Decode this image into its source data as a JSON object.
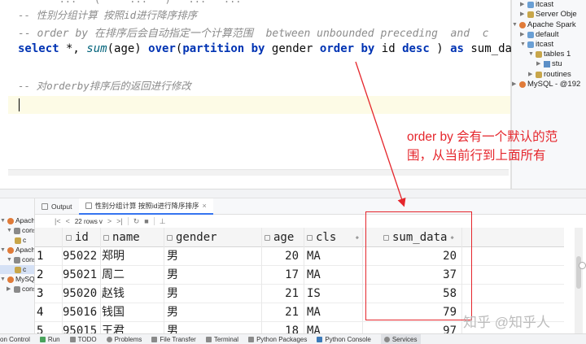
{
  "editor": {
    "top_line": "  --   ...   (     ...   )   ...   ...",
    "comment1": "-- 性别分组计算 按照id进行降序排序",
    "comment2": "-- order by 在排序后会自动指定一个计算范围  between unbounded preceding  and  c",
    "sql": {
      "kw_select": "select",
      "p1": " *, ",
      "fn_sum": "sum",
      "p2": "(age) ",
      "kw_over": "over",
      "p3": "(",
      "kw_partition_by": "partition by",
      "p4": " gender ",
      "kw_order_by": "order by",
      "p5": " id ",
      "kw_desc": "desc",
      "p6": " ) ",
      "kw_as": "as",
      "p7": " sum_data"
    },
    "comment3": "-- 对orderby排序后的返回进行修改"
  },
  "db_tree": [
    {
      "label": "itcast",
      "icon": "schema-icon"
    },
    {
      "label": "Server Obje",
      "icon": "folder-icon"
    },
    {
      "label": "Apache Spark",
      "icon": "datasource-icon"
    },
    {
      "label": "default",
      "icon": "schema-icon"
    },
    {
      "label": "itcast",
      "icon": "schema-icon"
    },
    {
      "label": "tables 1",
      "icon": "folder-icon"
    },
    {
      "label": "stu",
      "icon": "table-icon"
    },
    {
      "label": "routines",
      "icon": "folder-icon"
    },
    {
      "label": "MySQL - @192",
      "icon": "datasource-icon"
    }
  ],
  "annotation": {
    "line1": "order by 会有一个默认的范",
    "line2": "围，从当前行到上面所有"
  },
  "services": [
    {
      "label": "Apache",
      "icon": "datasource-icon"
    },
    {
      "label": "cons",
      "icon": "console-icon"
    },
    {
      "label": "c",
      "icon": "console-icon"
    },
    {
      "label": "Apache",
      "icon": "datasource-icon"
    },
    {
      "label": "cons",
      "icon": "console-icon"
    },
    {
      "label": "c",
      "icon": "console-icon"
    },
    {
      "label": "MySQL",
      "icon": "datasource-icon"
    },
    {
      "label": "cons",
      "icon": "console-icon"
    }
  ],
  "tabs": [
    {
      "label": "Output",
      "icon": "output-icon"
    },
    {
      "label": "性别分组计算 按照id进行降序排序",
      "icon": "table-icon",
      "close": "×"
    }
  ],
  "toolbar": {
    "first": "|<",
    "prev": "<",
    "rows": "22 rows",
    "rows_caret": "v",
    "next": ">",
    "last": ">|",
    "refresh": "↻",
    "stop": "■",
    "pin": "⊥"
  },
  "grid": {
    "columns": [
      "id",
      "name",
      "gender",
      "age",
      "cls",
      "sum_data"
    ],
    "rows": [
      {
        "n": "1",
        "id": "95022",
        "name": "郑明",
        "gender": "男",
        "age": "20",
        "cls": "MA",
        "sum_data": "20"
      },
      {
        "n": "2",
        "id": "95021",
        "name": "周二",
        "gender": "男",
        "age": "17",
        "cls": "MA",
        "sum_data": "37"
      },
      {
        "n": "3",
        "id": "95020",
        "name": "赵钱",
        "gender": "男",
        "age": "21",
        "cls": "IS",
        "sum_data": "58"
      },
      {
        "n": "4",
        "id": "95016",
        "name": "钱国",
        "gender": "男",
        "age": "21",
        "cls": "MA",
        "sum_data": "79"
      },
      {
        "n": "5",
        "id": "95015",
        "name": "王君",
        "gender": "男",
        "age": "18",
        "cls": "MA",
        "sum_data": "97"
      }
    ]
  },
  "watermark": "知乎 @知乎人",
  "statusbar": [
    {
      "label": "on Control",
      "icon": "vcs-icon"
    },
    {
      "label": "Run",
      "icon": "run-icon"
    },
    {
      "label": "TODO",
      "icon": "todo-icon"
    },
    {
      "label": "Problems",
      "icon": "problems-icon"
    },
    {
      "label": "File Transfer",
      "icon": "transfer-icon"
    },
    {
      "label": "Terminal",
      "icon": "terminal-icon"
    },
    {
      "label": "Python Packages",
      "icon": "packages-icon"
    },
    {
      "label": "Python Console",
      "icon": "python-icon"
    },
    {
      "label": "Services",
      "icon": "services-icon"
    }
  ]
}
